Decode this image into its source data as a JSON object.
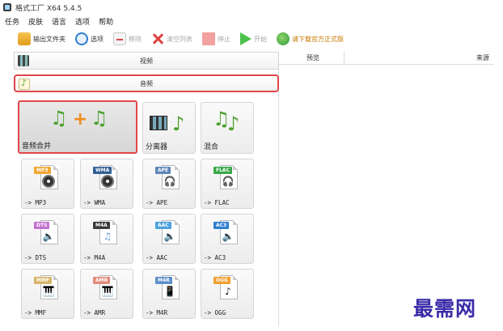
{
  "window": {
    "title": "格式工厂 X64 5.4.5"
  },
  "menu": [
    "任务",
    "皮肤",
    "语言",
    "选项",
    "帮助"
  ],
  "toolbar": {
    "output_folder": "输出文件夹",
    "options": "选项",
    "remove": "移除",
    "clear_list": "清空列表",
    "stop": "停止",
    "start": "开始",
    "download_link": "请下载官方正式版"
  },
  "categories": {
    "video": "视频",
    "audio": "音频"
  },
  "audio_tools": [
    {
      "label": "音频合并",
      "icon": "audio-merge-icon",
      "selected": true
    },
    {
      "label": "分离器",
      "icon": "splitter-icon",
      "selected": false
    },
    {
      "label": "混合",
      "icon": "mix-icon",
      "selected": false
    }
  ],
  "formats": [
    {
      "badge": "MP3",
      "label": "-> MP3",
      "color": "#f3a734",
      "glyph": "disc"
    },
    {
      "badge": "WMA",
      "label": "-> WMA",
      "color": "#2f5f97",
      "glyph": "disc"
    },
    {
      "badge": "APE",
      "label": "-> APE",
      "color": "#5f86b8",
      "glyph": "headphones"
    },
    {
      "badge": "FLAC",
      "label": "-> FLAC",
      "color": "#39a84a",
      "glyph": "headphones"
    },
    {
      "badge": "DTS",
      "label": "-> DTS",
      "color": "#c36fd0",
      "glyph": "speaker"
    },
    {
      "badge": "M4A",
      "label": "-> M4A",
      "color": "#3a3a3a",
      "glyph": "note"
    },
    {
      "badge": "AAC",
      "label": "-> AAC",
      "color": "#4aa1dd",
      "glyph": "speaker"
    },
    {
      "badge": "AC3",
      "label": "-> AC3",
      "color": "#2e7fd0",
      "glyph": "speaker"
    },
    {
      "badge": "MMF",
      "label": "-> MMF",
      "color": "#d8b46a",
      "glyph": "keyboard"
    },
    {
      "badge": "AMR",
      "label": "-> AMR",
      "color": "#e28b7a",
      "glyph": "keyboard"
    },
    {
      "badge": "M4R",
      "label": "-> M4R",
      "color": "#5b8fc8",
      "glyph": "phone"
    },
    {
      "badge": "OGG",
      "label": "-> OGG",
      "color": "#f0a030",
      "glyph": "note"
    }
  ],
  "task_list": {
    "col_preview": "预览",
    "col_source": "来源"
  },
  "watermark": "最需网"
}
